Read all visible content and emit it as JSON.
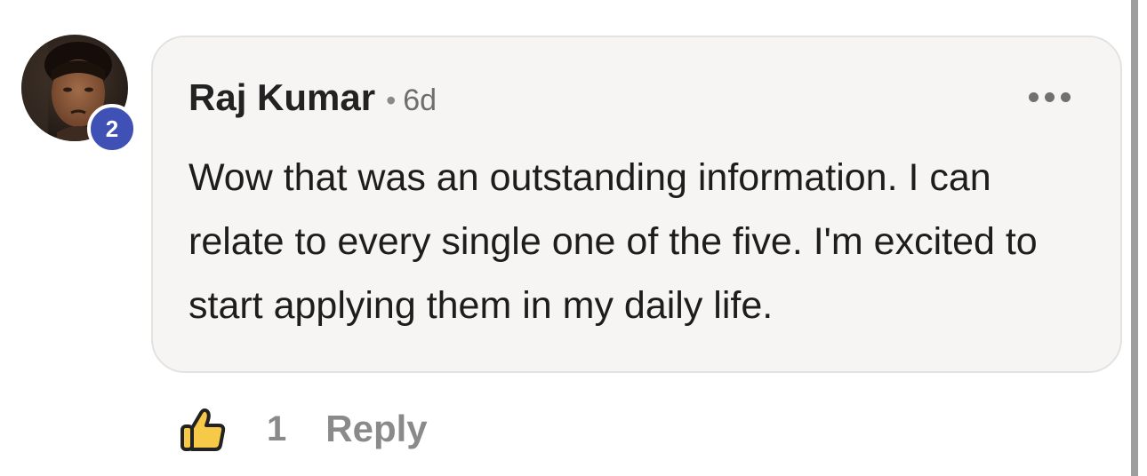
{
  "comment": {
    "author": "Raj Kumar",
    "separator": "•",
    "time": "6d",
    "badge": "2",
    "text": "Wow that was an outstanding information. I can relate to every single one of the five. I'm excited to start applying them in my daily life.",
    "menu_icon": "more-horizontal-icon"
  },
  "actions": {
    "like_icon": "thumbs-up-icon",
    "like_count": "1",
    "reply_label": "Reply"
  },
  "colors": {
    "badge": "#3f51b5",
    "bubble_bg": "#f6f5f4",
    "like_icon": "#f7c948",
    "muted_text": "#8a8a8a"
  }
}
